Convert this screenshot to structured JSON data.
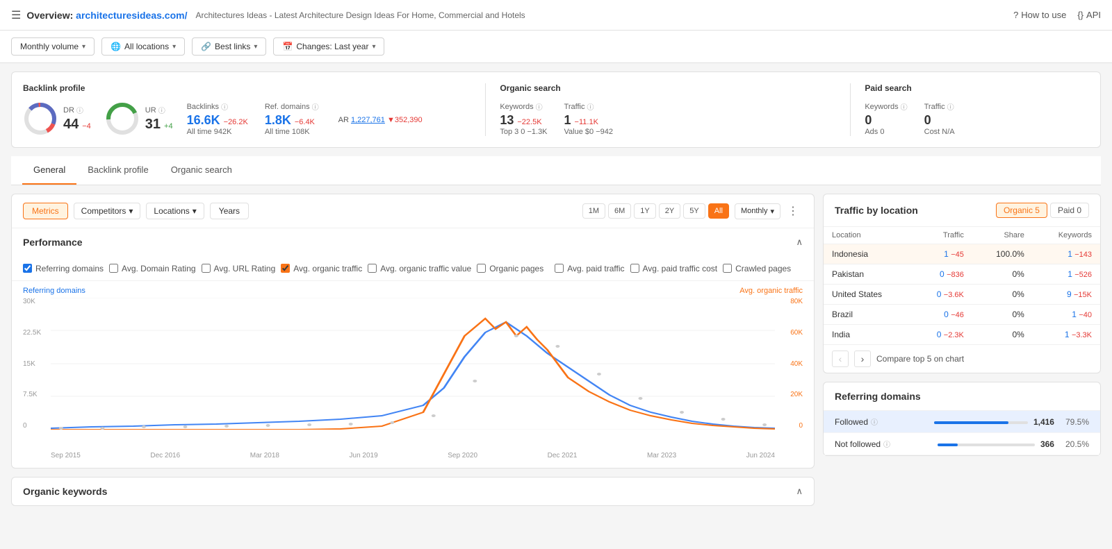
{
  "header": {
    "menu_icon": "☰",
    "title": "Overview: ",
    "site": "architecturesideas.com/",
    "description": "Architectures Ideas - Latest Architecture Design Ideas For Home, Commercial and Hotels",
    "help_label": "How to use",
    "api_label": "API"
  },
  "filters": {
    "volume_label": "Monthly volume",
    "locations_label": "All locations",
    "links_label": "Best links",
    "changes_label": "Changes: Last year"
  },
  "stats": {
    "backlink_profile_title": "Backlink profile",
    "organic_search_title": "Organic search",
    "paid_search_title": "Paid search",
    "dr_label": "DR",
    "dr_value": "44",
    "dr_change": "−4",
    "ur_label": "UR",
    "ur_value": "31",
    "ur_change": "+4",
    "backlinks_label": "Backlinks",
    "backlinks_value": "16.6K",
    "backlinks_change": "−26.2K",
    "backlinks_alltime": "All time  942K",
    "ref_domains_label": "Ref. domains",
    "ref_domains_value": "1.8K",
    "ref_domains_change": "−6.4K",
    "ref_domains_alltime": "All time  108K",
    "ar_label": "AR",
    "ar_value": "1,227,761",
    "ar_change": "▼352,390",
    "keywords_label": "Keywords",
    "keywords_value": "13",
    "keywords_change": "−22.5K",
    "keywords_top3": "Top 3  0  −1.3K",
    "traffic_label": "Traffic",
    "traffic_value": "1",
    "traffic_change": "−11.1K",
    "traffic_value_label": "Value $0  −942",
    "paid_keywords_label": "Keywords",
    "paid_keywords_value": "0",
    "paid_ads_label": "Ads  0",
    "paid_traffic_label": "Traffic",
    "paid_traffic_value": "0",
    "paid_cost_label": "Cost  N/A"
  },
  "tabs": [
    {
      "id": "general",
      "label": "General",
      "active": true
    },
    {
      "id": "backlink",
      "label": "Backlink profile",
      "active": false
    },
    {
      "id": "organic",
      "label": "Organic search",
      "active": false
    }
  ],
  "chart_controls": {
    "metrics_tab_label": "Metrics",
    "competitors_label": "Competitors",
    "locations_label": "Locations",
    "years_label": "Years",
    "time_buttons": [
      "1M",
      "6M",
      "1Y",
      "2Y",
      "5Y",
      "All"
    ],
    "active_time": "All",
    "monthly_label": "Monthly"
  },
  "performance": {
    "title": "Performance",
    "checkboxes": [
      {
        "id": "ref_domains",
        "label": "Referring domains",
        "checked": true,
        "color": "blue"
      },
      {
        "id": "avg_dr",
        "label": "Avg. Domain Rating",
        "checked": false
      },
      {
        "id": "avg_url",
        "label": "Avg. URL Rating",
        "checked": false
      },
      {
        "id": "avg_organic",
        "label": "Avg. organic traffic",
        "checked": true,
        "color": "orange"
      },
      {
        "id": "avg_organic_val",
        "label": "Avg. organic traffic value",
        "checked": false
      },
      {
        "id": "organic_pages",
        "label": "Organic pages",
        "checked": false
      },
      {
        "id": "avg_paid",
        "label": "Avg. paid traffic",
        "checked": false
      },
      {
        "id": "avg_paid_cost",
        "label": "Avg. paid traffic cost",
        "checked": false
      },
      {
        "id": "crawled",
        "label": "Crawled pages",
        "checked": false
      }
    ],
    "legend_left": "Referring domains",
    "legend_right": "Avg. organic traffic",
    "y_axis_left": [
      "30K",
      "22.5K",
      "15K",
      "7.5K",
      "0"
    ],
    "y_axis_right": [
      "80K",
      "60K",
      "40K",
      "20K",
      "0"
    ],
    "x_axis": [
      "Sep 2015",
      "Dec 2016",
      "Mar 2018",
      "Jun 2019",
      "Sep 2020",
      "Dec 2021",
      "Mar 2023",
      "Jun 2024"
    ]
  },
  "traffic_by_location": {
    "title": "Traffic by location",
    "organic_tab": "Organic 5",
    "paid_tab": "Paid 0",
    "columns": [
      "Location",
      "Traffic",
      "Share",
      "Keywords"
    ],
    "rows": [
      {
        "location": "Indonesia",
        "traffic": "1",
        "traffic_change": "−45",
        "share": "100.0%",
        "keywords": "1",
        "keywords_change": "−143",
        "highlighted": true
      },
      {
        "location": "Pakistan",
        "traffic": "0",
        "traffic_change": "−836",
        "share": "0%",
        "keywords": "1",
        "keywords_change": "−526"
      },
      {
        "location": "United States",
        "traffic": "0",
        "traffic_change": "−3.6K",
        "share": "0%",
        "keywords": "9",
        "keywords_change": "−15K"
      },
      {
        "location": "Brazil",
        "traffic": "0",
        "traffic_change": "−46",
        "share": "0%",
        "keywords": "1",
        "keywords_change": "−40"
      },
      {
        "location": "India",
        "traffic": "0",
        "traffic_change": "−2.3K",
        "share": "0%",
        "keywords": "1",
        "keywords_change": "−3.3K"
      }
    ],
    "compare_label": "Compare top 5 on chart"
  },
  "referring_domains": {
    "title": "Referring domains",
    "rows": [
      {
        "label": "Followed",
        "value": "1,416",
        "percent": "79.5%",
        "bar": 79.5,
        "highlighted": true
      },
      {
        "label": "Not followed",
        "value": "366",
        "percent": "20.5%",
        "bar": 20.5,
        "highlighted": false
      }
    ]
  },
  "organic_keywords": {
    "title": "Organic keywords"
  }
}
